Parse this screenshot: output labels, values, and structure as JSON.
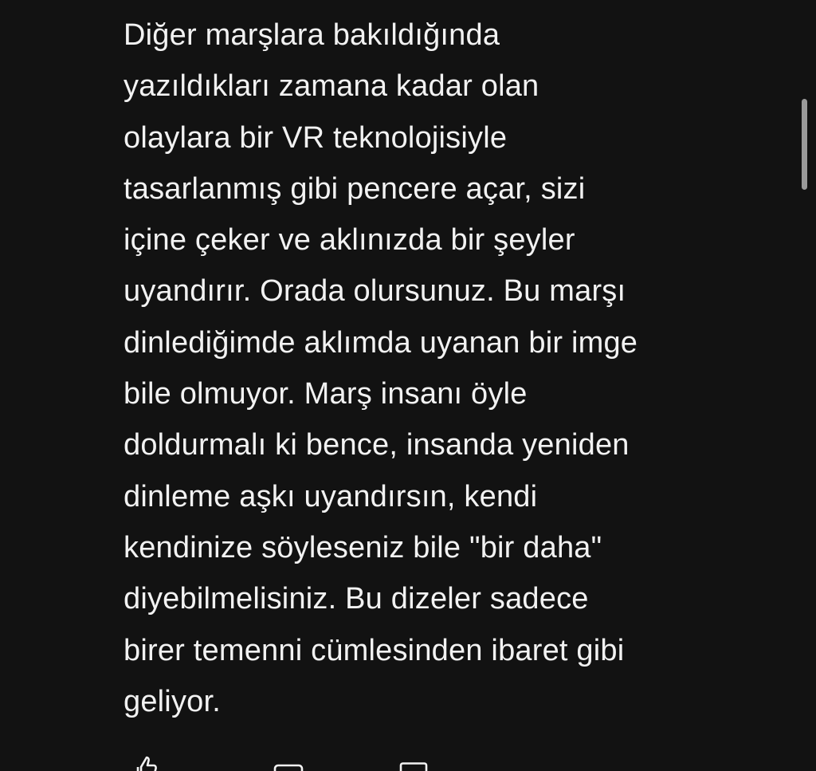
{
  "article": {
    "previous_line_fragment": "",
    "lines": [
      "Diğer marşlara bakıldığında",
      "yazıldıkları zamana kadar olan",
      "olaylara bir VR teknolojisiyle",
      "tasarlanmış gibi pencere açar, sizi",
      "içine çeker ve aklınızda bir şeyler",
      "uyandırır. Orada olursunuz. Bu marşı",
      "dinlediğimde aklımda uyanan bir imge",
      "bile olmuyor. Marş insanı öyle",
      "doldurmalı ki bence, insanda yeniden",
      "dinleme aşkı uyandırsın, kendi",
      "kendinize söyleseniz bile \"bir daha\"",
      "diyebilmelisiniz. Bu dizeler sadece",
      "birer temenni cümlesinden ibaret gibi",
      "geliyor."
    ]
  },
  "actions": {
    "like_icon": "thumbs-up-icon",
    "like_count": "",
    "comment_icon": "comment-icon",
    "bookmark_icon": "bookmark-icon"
  },
  "colors": {
    "background": "#121212",
    "text": "#f2f2f2",
    "scrollbar": "#9a9a9a"
  }
}
